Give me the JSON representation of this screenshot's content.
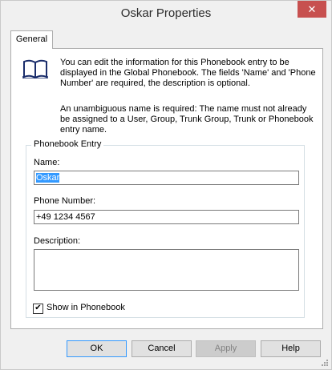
{
  "window": {
    "title": "Oskar Properties",
    "close_label": "✕"
  },
  "tabs": [
    {
      "label": "General"
    }
  ],
  "info": {
    "paragraph1": "You can edit the information for this Phonebook entry to be displayed in the Global Phonebook. The fields 'Name' and 'Phone Number' are required, the description is optional.",
    "paragraph2": "An unambiguous name is required: The name must not already be assigned to a User, Group, Trunk Group, Trunk or Phonebook entry name."
  },
  "group": {
    "legend": "Phonebook Entry",
    "name_label": "Name:",
    "name_value": "Oskar",
    "phone_label": "Phone Number:",
    "phone_value": "+49 1234 4567",
    "description_label": "Description:",
    "description_value": "",
    "show_in_phonebook_label": "Show in Phonebook",
    "show_in_phonebook_checked": true
  },
  "buttons": {
    "ok": "OK",
    "cancel": "Cancel",
    "apply": "Apply",
    "help": "Help"
  }
}
